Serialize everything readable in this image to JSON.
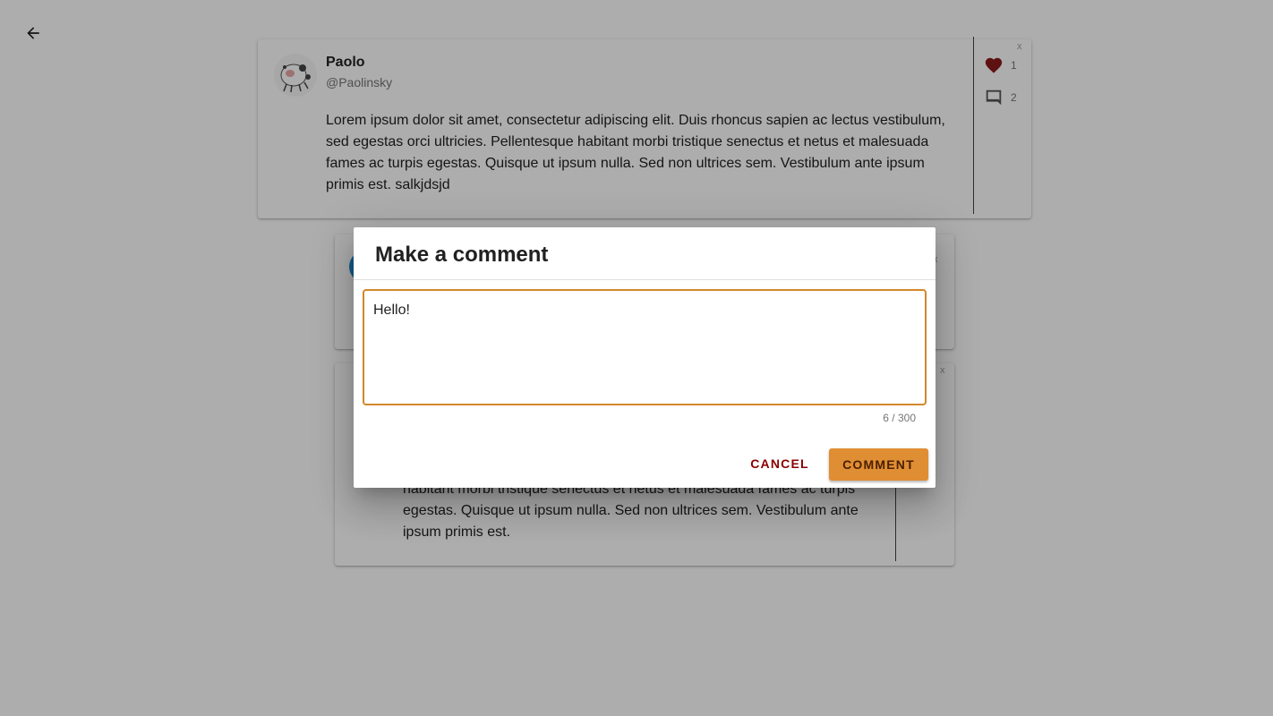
{
  "nav": {
    "back_icon": "arrow-back-icon"
  },
  "posts": [
    {
      "name": "Paolo",
      "handle": "@Paolinsky",
      "text": "Lorem ipsum dolor sit amet, consectetur adipiscing elit. Duis rhoncus sapien ac lectus vestibulum, sed egestas orci ultricies. Pellentesque habitant morbi tristique senectus et netus et malesuada fames ac turpis egestas. Quisque ut ipsum nulla. Sed non ultrices sem. Vestibulum ante ipsum primis est. salkjdsjd",
      "likes": "1",
      "comments": "2",
      "close": "x"
    },
    {
      "close": "x"
    },
    {
      "text": "habitant morbi tristique senectus et netus et malesuada fames ac turpis egestas. Quisque ut ipsum nulla. Sed non ultrices sem. Vestibulum ante ipsum primis est.",
      "close": "x"
    }
  ],
  "dialog": {
    "title": "Make a comment",
    "comment_value": "Hello!",
    "counter": "6 / 300",
    "cancel_label": "CANCEL",
    "submit_label": "COMMENT"
  },
  "colors": {
    "accent": "#e08e34",
    "cancel_text": "#8b0000",
    "heart": "#8b1a1a",
    "overlay": "rgba(0,0,0,0.32)"
  }
}
